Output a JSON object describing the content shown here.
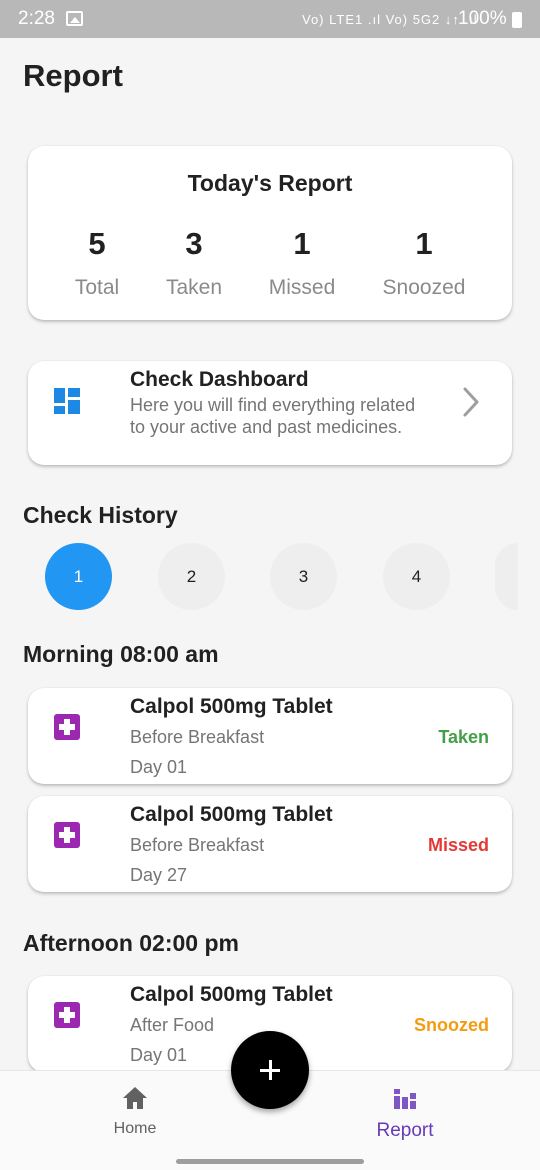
{
  "status_bar": {
    "time": "2:28",
    "network_icons": "Vo) LTE1 .ıl Vo) 5G2 ↓↑ .ıl",
    "battery": "100%"
  },
  "page": {
    "title": "Report"
  },
  "today_report": {
    "title": "Today's Report",
    "stats": [
      {
        "value": "5",
        "label": "Total"
      },
      {
        "value": "3",
        "label": "Taken"
      },
      {
        "value": "1",
        "label": "Missed"
      },
      {
        "value": "1",
        "label": "Snoozed"
      }
    ]
  },
  "dashboard": {
    "title": "Check Dashboard",
    "description": "Here you will find everything related to your active and past medicines.",
    "icon": "dashboard-icon",
    "icon_color": "#1e88e5"
  },
  "history": {
    "title": "Check History",
    "days": [
      "1",
      "2",
      "3",
      "4"
    ],
    "active_index": 0,
    "active_color": "#2196f3"
  },
  "groups": [
    {
      "title": "Morning 08:00 am",
      "items": [
        {
          "name": "Calpol 500mg Tablet",
          "note": "Before Breakfast",
          "day": "Day 01",
          "status": "Taken",
          "status_color": "#43a047"
        },
        {
          "name": "Calpol 500mg Tablet",
          "note": "Before Breakfast",
          "day": "Day 27",
          "status": "Missed",
          "status_color": "#e53935"
        }
      ]
    },
    {
      "title": "Afternoon 02:00 pm",
      "items": [
        {
          "name": "Calpol 500mg Tablet",
          "note": "After Food",
          "day": "Day 01",
          "status": "Snoozed",
          "status_color": "#f39c12"
        }
      ]
    }
  ],
  "medicine_icon_color": "#9c27b0",
  "bottom_nav": {
    "items": [
      {
        "label": "Home",
        "icon": "home-icon"
      },
      {
        "label": "Report",
        "icon": "report-icon"
      }
    ],
    "active_color": "#673ab7",
    "fab_icon": "plus-icon"
  }
}
